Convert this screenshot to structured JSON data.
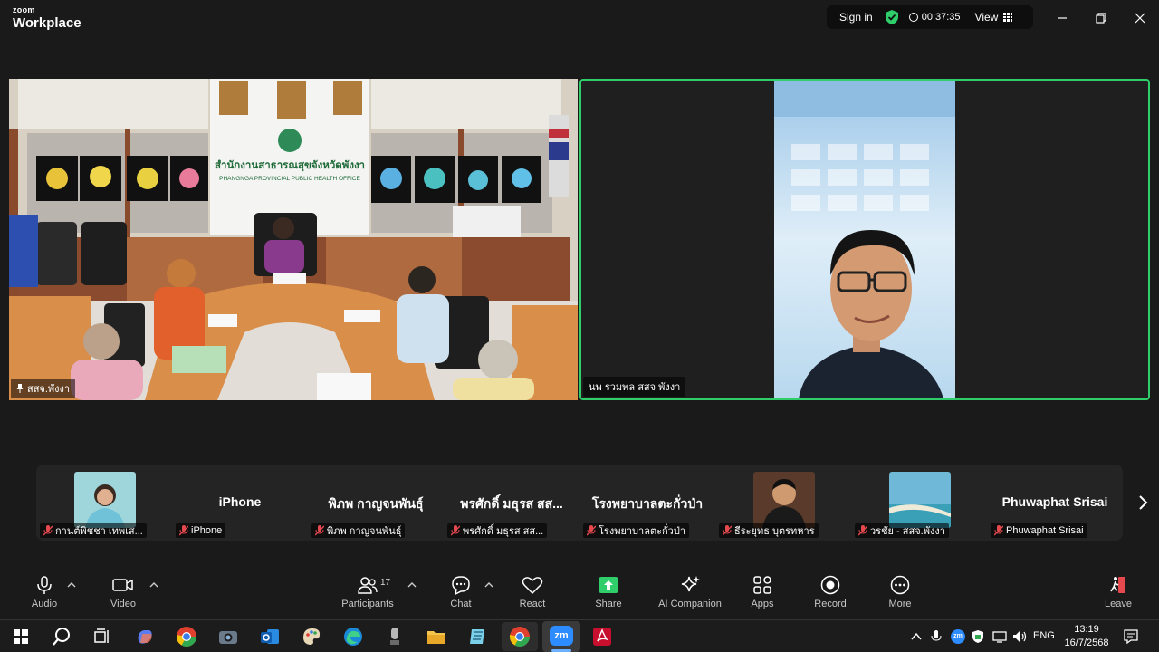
{
  "app": {
    "brand_small": "zoom",
    "brand_big": "Workplace",
    "sign_in": "Sign in",
    "timer": "00:37:35",
    "view": "View"
  },
  "main_videos": [
    {
      "name": "สสจ.พังงา",
      "sign_top": "สำนักงานสาธารณสุขจังหวัดพังงา",
      "sign_bottom": "PHANGNGA PROVINCIAL PUBLIC HEALTH OFFICE"
    },
    {
      "name": "นพ รวมพล สสจ พังงา"
    }
  ],
  "participants_strip": [
    {
      "name": "กานต์พิชชา เทพเส...",
      "display": "",
      "has_video": true
    },
    {
      "name": "iPhone",
      "display": "iPhone",
      "has_video": false
    },
    {
      "name": "พิภพ กาญจนพันธุ์",
      "display": "พิภพ กาญจนพันธุ์",
      "has_video": false
    },
    {
      "name": "พรศักดิ์ มธุรส สส...",
      "display": "พรศักดิ์ มธุรส สส...",
      "has_video": false
    },
    {
      "name": "โรงพยาบาลตะกั่วป่า",
      "display": "โรงพยาบาลตะกั่วป่า",
      "has_video": false
    },
    {
      "name": "ธีระยุทธ บุตรทหาร",
      "display": "",
      "has_video": true
    },
    {
      "name": "วรชัย - สสจ.พังงา",
      "display": "",
      "has_video": true
    },
    {
      "name": "Phuwaphat Srisai",
      "display": "Phuwaphat Srisai",
      "has_video": false
    }
  ],
  "toolbar": {
    "audio": "Audio",
    "video": "Video",
    "participants": "Participants",
    "participants_count": "17",
    "chat": "Chat",
    "react": "React",
    "share": "Share",
    "ai_companion": "AI Companion",
    "apps": "Apps",
    "record": "Record",
    "more": "More",
    "leave": "Leave"
  },
  "taskbar": {
    "lang": "ENG",
    "time": "13:19",
    "date": "16/7/2568",
    "zoom_label": "zm"
  },
  "colors": {
    "active_speaker_border": "#2fce6a",
    "share_green": "#2fce6a",
    "muted_red": "#e5484d"
  }
}
